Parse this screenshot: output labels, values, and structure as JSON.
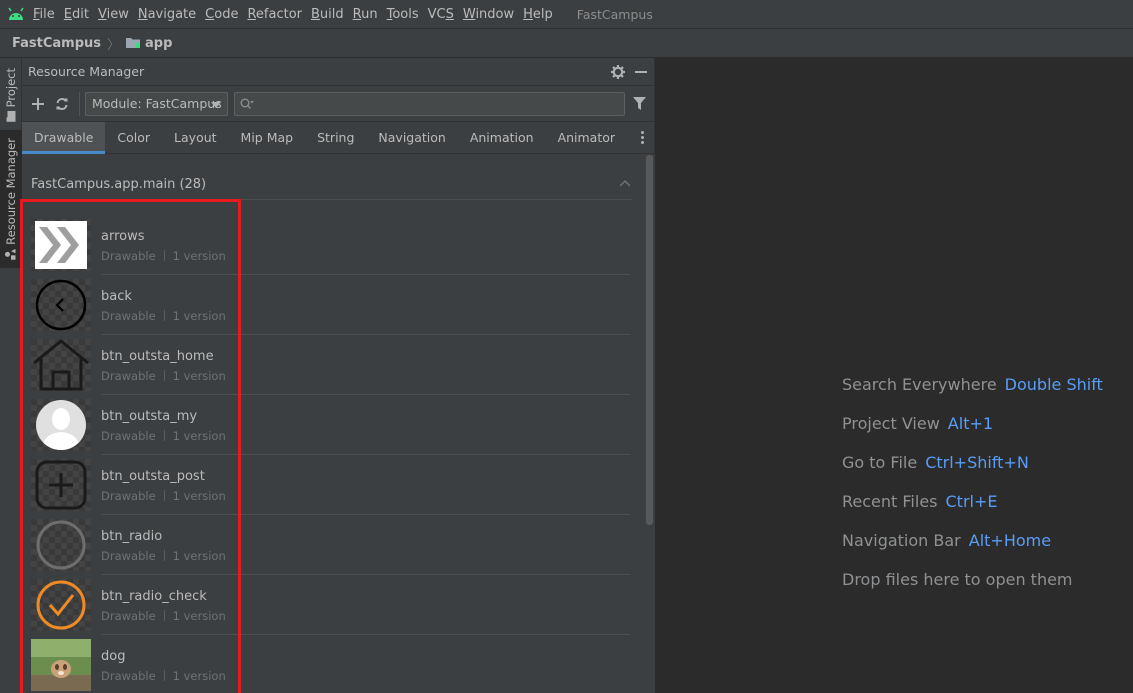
{
  "menubar": {
    "items": [
      {
        "label": "File",
        "mnemonic": "F",
        "rest": "ile"
      },
      {
        "label": "Edit",
        "mnemonic": "E",
        "rest": "dit"
      },
      {
        "label": "View",
        "mnemonic": "V",
        "rest": "iew"
      },
      {
        "label": "Navigate",
        "mnemonic": "N",
        "rest": "avigate"
      },
      {
        "label": "Code",
        "mnemonic": "C",
        "rest": "ode"
      },
      {
        "label": "Refactor",
        "mnemonic": "R",
        "rest": "efactor"
      },
      {
        "label": "Build",
        "mnemonic": "B",
        "rest": "uild"
      },
      {
        "label": "Run",
        "mnemonic": "R",
        "rest": "un",
        "mnemonic_pos": 0
      },
      {
        "label": "Tools",
        "mnemonic": "T",
        "rest": "ools"
      },
      {
        "label": "VCS",
        "mnemonic": "S",
        "rest": "VC",
        "suffix": true
      },
      {
        "label": "Window",
        "mnemonic": "W",
        "rest": "indow"
      },
      {
        "label": "Help",
        "mnemonic": "H",
        "rest": "elp"
      }
    ],
    "project_title": "FastCampus"
  },
  "breadcrumb": {
    "project": "FastCampus",
    "module": "app"
  },
  "left_strip": {
    "project_tab": "Project",
    "resource_tab": "Resource Manager"
  },
  "panel": {
    "title": "Resource Manager",
    "module_select": "Module: FastCampus",
    "search_value": "",
    "tabs": [
      "Drawable",
      "Color",
      "Layout",
      "Mip Map",
      "String",
      "Navigation",
      "Animation",
      "Animator"
    ],
    "active_tab": "Drawable",
    "group_title": "FastCampus.app.main (28)",
    "resources": [
      {
        "name": "arrows",
        "type": "Drawable",
        "versions": "1 version",
        "icon": "arrows-thumbnail"
      },
      {
        "name": "back",
        "type": "Drawable",
        "versions": "1 version",
        "icon": "back-thumbnail"
      },
      {
        "name": "btn_outsta_home",
        "type": "Drawable",
        "versions": "1 version",
        "icon": "home-thumbnail"
      },
      {
        "name": "btn_outsta_my",
        "type": "Drawable",
        "versions": "1 version",
        "icon": "user-thumbnail"
      },
      {
        "name": "btn_outsta_post",
        "type": "Drawable",
        "versions": "1 version",
        "icon": "post-thumbnail"
      },
      {
        "name": "btn_radio",
        "type": "Drawable",
        "versions": "1 version",
        "icon": "radio-thumbnail"
      },
      {
        "name": "btn_radio_check",
        "type": "Drawable",
        "versions": "1 version",
        "icon": "radio-check-thumbnail"
      },
      {
        "name": "dog",
        "type": "Drawable",
        "versions": "1 version",
        "icon": "dog-photo-thumbnail"
      }
    ]
  },
  "editor": {
    "hints": [
      {
        "label": "Search Everywhere",
        "key": "Double Shift"
      },
      {
        "label": "Project View",
        "key": "Alt+1"
      },
      {
        "label": "Go to File",
        "key": "Ctrl+Shift+N"
      },
      {
        "label": "Recent Files",
        "key": "Ctrl+E"
      },
      {
        "label": "Navigation Bar",
        "key": "Alt+Home"
      },
      {
        "label": "Drop files here to open them",
        "key": ""
      }
    ]
  },
  "colors": {
    "accent": "#4a88c7",
    "highlight": "#e81a1f",
    "shortcut": "#589df6",
    "android": "#3ddc84"
  }
}
